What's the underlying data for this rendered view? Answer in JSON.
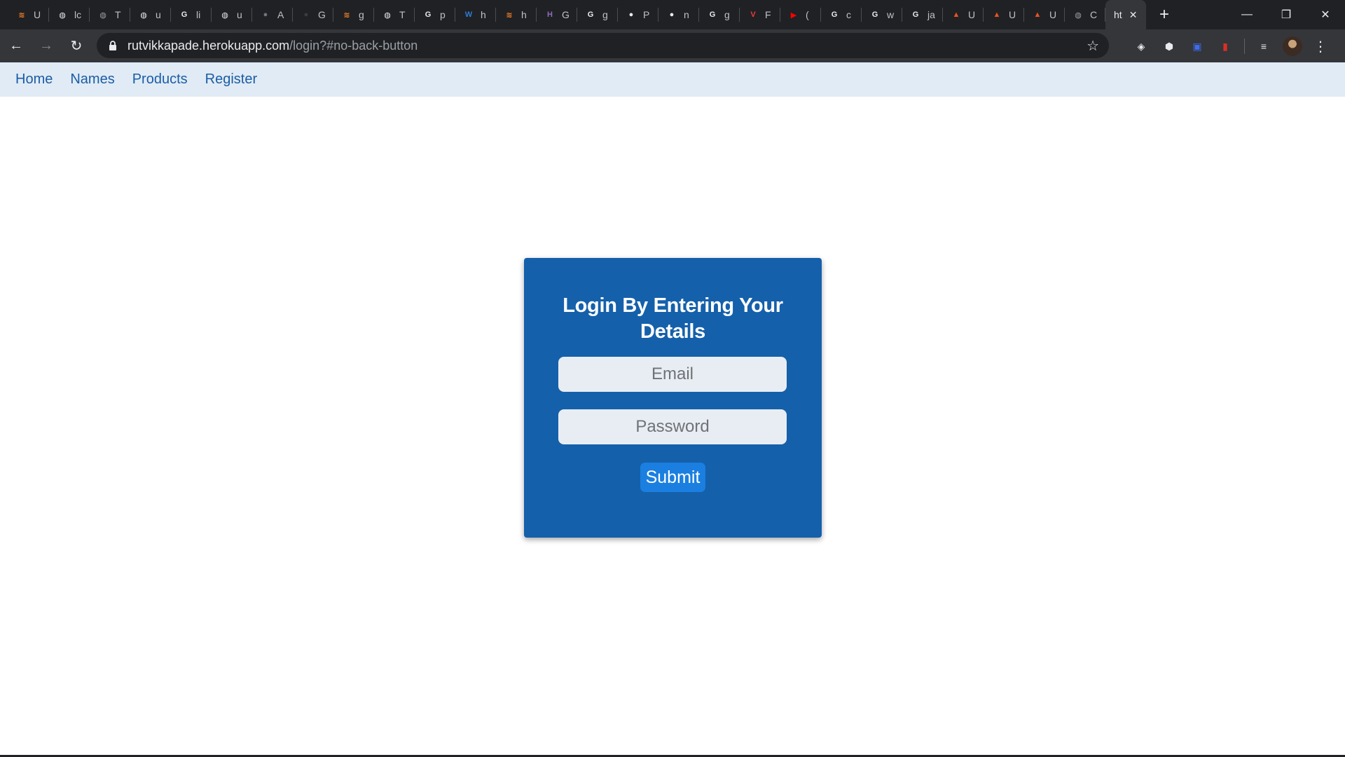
{
  "browser": {
    "tabs": [
      {
        "label": "U",
        "icon": "stackoverflow-icon",
        "color": "#f48024",
        "glyph": "≋"
      },
      {
        "label": "lc",
        "icon": "globe-icon",
        "color": "#e8eaed",
        "glyph": "◍"
      },
      {
        "label": "T",
        "icon": "globe-icon",
        "color": "#9aa0a6",
        "glyph": "◍"
      },
      {
        "label": "u",
        "icon": "globe-icon",
        "color": "#e8eaed",
        "glyph": "◍"
      },
      {
        "label": "li",
        "icon": "google-icon",
        "color": "#e8eaed",
        "glyph": "G"
      },
      {
        "label": "u",
        "icon": "globe-icon",
        "color": "#e8eaed",
        "glyph": "◍"
      },
      {
        "label": "A",
        "icon": "github-icon",
        "color": "#6e7681",
        "glyph": "●"
      },
      {
        "label": "G",
        "icon": "github-icon",
        "color": "#3a3d41",
        "glyph": "●"
      },
      {
        "label": "g",
        "icon": "stackoverflow-icon",
        "color": "#f48024",
        "glyph": "≋"
      },
      {
        "label": "T",
        "icon": "globe-icon",
        "color": "#e8eaed",
        "glyph": "◍"
      },
      {
        "label": "p",
        "icon": "google-icon",
        "color": "#e8eaed",
        "glyph": "G"
      },
      {
        "label": "h",
        "icon": "word-icon",
        "color": "#2b7cd3",
        "glyph": "W"
      },
      {
        "label": "h",
        "icon": "stackoverflow-icon",
        "color": "#f48024",
        "glyph": "≋"
      },
      {
        "label": "G",
        "icon": "hackerearth-icon",
        "color": "#8e6bbf",
        "glyph": "H"
      },
      {
        "label": "g",
        "icon": "google-icon",
        "color": "#e8eaed",
        "glyph": "G"
      },
      {
        "label": "P",
        "icon": "github-icon",
        "color": "#e8eaed",
        "glyph": "●"
      },
      {
        "label": "n",
        "icon": "github-icon",
        "color": "#e8eaed",
        "glyph": "●"
      },
      {
        "label": "g",
        "icon": "google-icon",
        "color": "#e8eaed",
        "glyph": "G"
      },
      {
        "label": "F",
        "icon": "vivaldi-icon",
        "color": "#ef3939",
        "glyph": "V"
      },
      {
        "label": "(",
        "icon": "youtube-icon",
        "color": "#ff0000",
        "glyph": "▶"
      },
      {
        "label": "c",
        "icon": "google-icon",
        "color": "#e8eaed",
        "glyph": "G"
      },
      {
        "label": "w",
        "icon": "google-icon",
        "color": "#e8eaed",
        "glyph": "G"
      },
      {
        "label": "ja",
        "icon": "google-icon",
        "color": "#e8eaed",
        "glyph": "G"
      },
      {
        "label": "U",
        "icon": "ubuntu-icon",
        "color": "#e95420",
        "glyph": "▲"
      },
      {
        "label": "U",
        "icon": "ubuntu-icon",
        "color": "#e95420",
        "glyph": "▲"
      },
      {
        "label": "U",
        "icon": "ubuntu-icon",
        "color": "#e95420",
        "glyph": "▲"
      },
      {
        "label": "C",
        "icon": "globe-icon",
        "color": "#9aa0a6",
        "glyph": "◍"
      }
    ],
    "active_tab": {
      "label": "ht",
      "close": "✕"
    },
    "new_tab": "+",
    "window": {
      "minimize": "—",
      "restore": "❐",
      "close": "✕"
    },
    "nav": {
      "back": "←",
      "forward": "→",
      "reload": "↻"
    },
    "url": {
      "host": "rutvikkapade.herokuapp.com",
      "path": "/login?#no-back-button"
    },
    "bookmark_star": "☆",
    "extensions": [
      {
        "name": "shield-extension-icon",
        "glyph": "◈",
        "color": "#e8eaed"
      },
      {
        "name": "cube-extension-icon",
        "glyph": "⬢",
        "color": "#e8eaed"
      },
      {
        "name": "screen-extension-icon",
        "glyph": "▣",
        "color": "#3d6cf0"
      },
      {
        "name": "bookmark-extension-icon",
        "glyph": "▮",
        "color": "#d93025"
      }
    ],
    "media_icon": "≡",
    "menu": "⋮"
  },
  "site_nav": {
    "links": [
      "Home",
      "Names",
      "Products",
      "Register"
    ],
    "color": "#1a5da6",
    "background": "#e1ebf5"
  },
  "login": {
    "title": "Login By Entering Your Details",
    "email_placeholder": "Email",
    "email_value": "",
    "password_placeholder": "Password",
    "password_value": "",
    "submit_label": "Submit",
    "card_color": "#1560ab",
    "button_color": "#1a7fe0"
  }
}
